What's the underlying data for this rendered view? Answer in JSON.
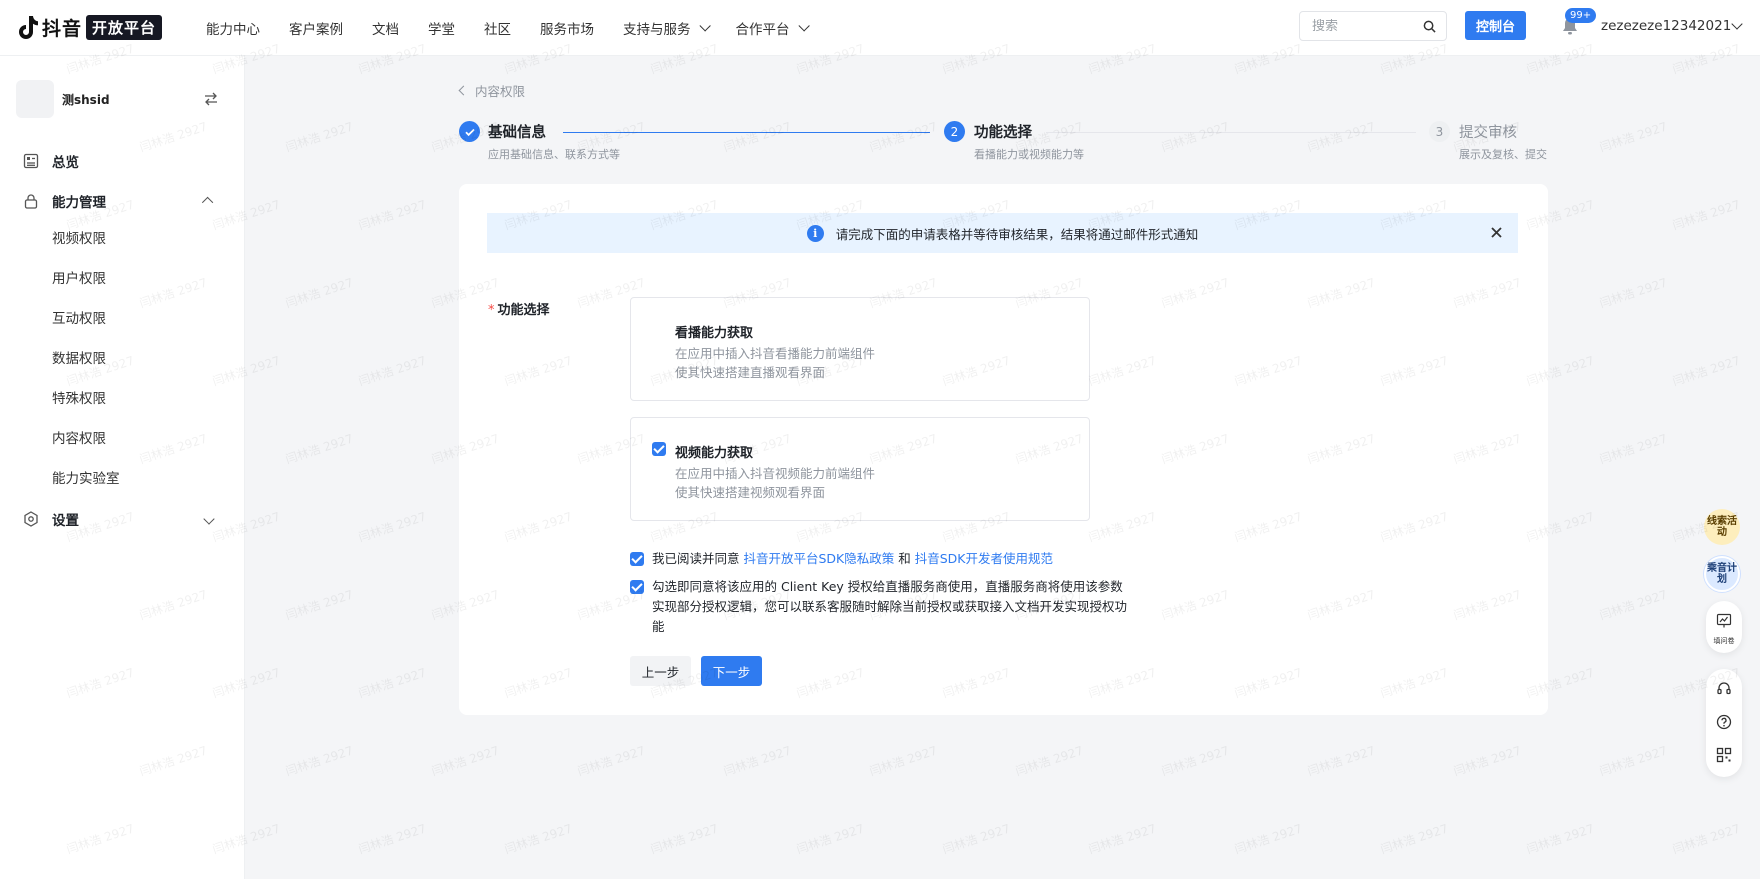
{
  "topnav": {
    "logo_text": "抖音",
    "logo_badge": "开放平台",
    "items": [
      {
        "label": "能力中心",
        "dropdown": false
      },
      {
        "label": "客户案例",
        "dropdown": false
      },
      {
        "label": "文档",
        "dropdown": false
      },
      {
        "label": "学堂",
        "dropdown": false
      },
      {
        "label": "社区",
        "dropdown": false
      },
      {
        "label": "服务市场",
        "dropdown": false
      },
      {
        "label": "支持与服务",
        "dropdown": true
      },
      {
        "label": "合作平台",
        "dropdown": true
      }
    ],
    "search_placeholder": "搜索",
    "console_label": "控制台",
    "notification_badge": "99+",
    "username": "zezezeze12342021"
  },
  "sidebar": {
    "app_name": "测shsid",
    "menu": [
      {
        "label": "总览",
        "icon": "dashboard-icon"
      },
      {
        "label": "能力管理",
        "icon": "lock-icon",
        "expanded": true
      },
      {
        "label": "设置",
        "icon": "settings-icon",
        "expanded": false
      }
    ],
    "sub_items": [
      "视频权限",
      "用户权限",
      "互动权限",
      "数据权限",
      "特殊权限",
      "内容权限",
      "能力实验室"
    ]
  },
  "breadcrumb": "内容权限",
  "steps": [
    {
      "num": "",
      "title": "基础信息",
      "desc": "应用基础信息、联系方式等",
      "status": "done"
    },
    {
      "num": "2",
      "title": "功能选择",
      "desc": "看播能力或视频能力等",
      "status": "active"
    },
    {
      "num": "3",
      "title": "提交审核",
      "desc": "展示及复核、提交",
      "status": "wait"
    }
  ],
  "notice": "请完成下面的申请表格并等待审核结果，结果将通过邮件形式通知",
  "form": {
    "required_mark": "*",
    "label": "功能选择",
    "options": [
      {
        "title": "看播能力获取",
        "desc1": "在应用中插入抖音看播能力前端组件",
        "desc2": "使其快速搭建直播观看界面",
        "checked": false
      },
      {
        "title": "视频能力获取",
        "desc1": "在应用中插入抖音视频能力前端组件",
        "desc2": "使其快速搭建视频观看界面",
        "checked": true
      }
    ],
    "agreement1": {
      "prefix": "我已阅读并同意",
      "link1": "抖音开放平台SDK隐私政策",
      "and": "和",
      "link2": "抖音SDK开发者使用规范",
      "checked": true
    },
    "agreement2": {
      "text": "勾选即同意将该应用的 Client Key 授权给直播服务商使用，直播服务商将使用该参数实现部分授权逻辑，您可以联系客服随时解除当前授权或获取接入文档开发实现授权功能",
      "checked": true
    },
    "prev_label": "上一步",
    "next_label": "下一步"
  },
  "float_tools": {
    "badge1": "线索活动",
    "badge2": "乘音计划",
    "survey_label": "填问卷"
  },
  "watermark": "闫林浩 2927",
  "colors": {
    "primary": "#2f7bf0",
    "notice_bg": "#e8f3ff",
    "required": "#f54a45"
  }
}
